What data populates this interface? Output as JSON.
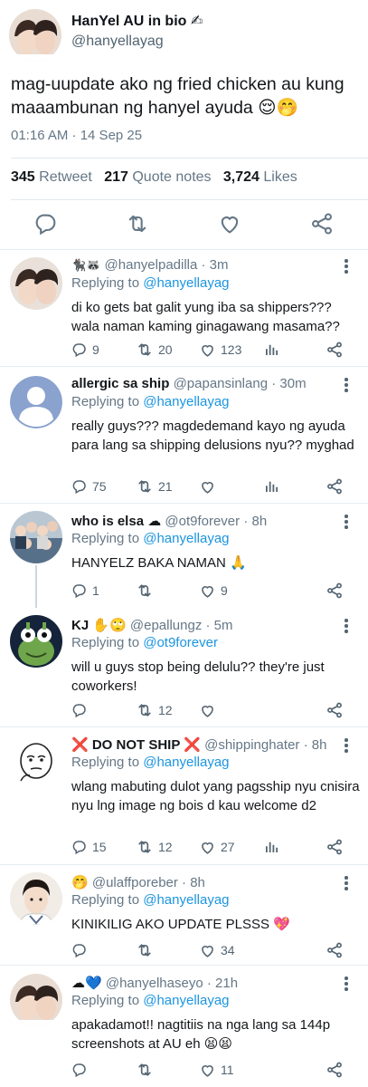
{
  "main": {
    "name": "HanYel AU in bio ✍",
    "handle": "@hanyellayag",
    "text": "mag-uupdate ako ng fried chicken au kung maaambunan ng hanyel ayuda 😌🤭",
    "time": "01:16 AM · 14 Sep 25",
    "retweets": "345",
    "retweets_label": "Retweet",
    "quotes": "217",
    "quotes_label": "Quote notes",
    "likes": "3,724",
    "likes_label": "Likes"
  },
  "replies": [
    {
      "name": "🐈‍⬛🦝",
      "handle": "@hanyelpadilla",
      "time": "· 3m",
      "replying_label": "Replying to",
      "replying_to": "@hanyellayag",
      "text": "di ko gets bat galit yung iba sa shippers??? wala naman kaming ginagawang masama??",
      "replies": "9",
      "retweets": "20",
      "likes": "123"
    },
    {
      "name": "allergic sa ship",
      "handle": "@papansinlang",
      "time": "· 30m",
      "replying_label": "Replying to",
      "replying_to": "@hanyellayag",
      "text": "really guys??? magdedemand kayo ng ayuda para lang sa shipping delusions nyu?? myghad",
      "replies": "75",
      "retweets": "21",
      "likes": ""
    },
    {
      "name": "who is elsa ☁",
      "handle": "@ot9forever",
      "time": "· 8h",
      "replying_label": "Replying to",
      "replying_to": "@hanyellayag",
      "text": "HANYELZ BAKA NAMAN 🙏",
      "replies": "1",
      "retweets": "",
      "likes": "9"
    },
    {
      "name": "KJ ✋🙄",
      "handle": "@epallungz",
      "time": "· 5m",
      "replying_label": "Replying to",
      "replying_to": "@ot9forever",
      "text": "will u guys stop being delulu?? they're just coworkers!",
      "replies": "",
      "retweets": "12",
      "likes": ""
    },
    {
      "name": "❌ DO NOT SHIP ❌",
      "handle": "@shippinghater",
      "time": "· 8h",
      "replying_label": "Replying to",
      "replying_to": "@hanyellayag",
      "text": "wlang mabuting dulot yang pagsship nyu cnisira nyu lng image ng bois d kau welcome d2",
      "replies": "15",
      "retweets": "12",
      "likes": "27"
    },
    {
      "name": "🤭",
      "handle": "@ulaffporeber",
      "time": "· 8h",
      "replying_label": "Replying to",
      "replying_to": "@hanyellayag",
      "text": "KINIKILIG AKO UPDATE PLSSS 💖",
      "replies": "",
      "retweets": "",
      "likes": "34"
    },
    {
      "name": "☁💙",
      "handle": "@hanyelhaseyo",
      "time": "· 21h",
      "replying_label": "Replying to",
      "replying_to": "@hanyellayag",
      "text": "apakadamot!! nagtitiis na nga lang sa 144p screenshots at AU eh 😫😫",
      "replies": "",
      "retweets": "",
      "likes": "11"
    }
  ],
  "colors": {
    "link": "#1b95e0",
    "muted": "#657786",
    "divider": "#e6ecf0"
  }
}
